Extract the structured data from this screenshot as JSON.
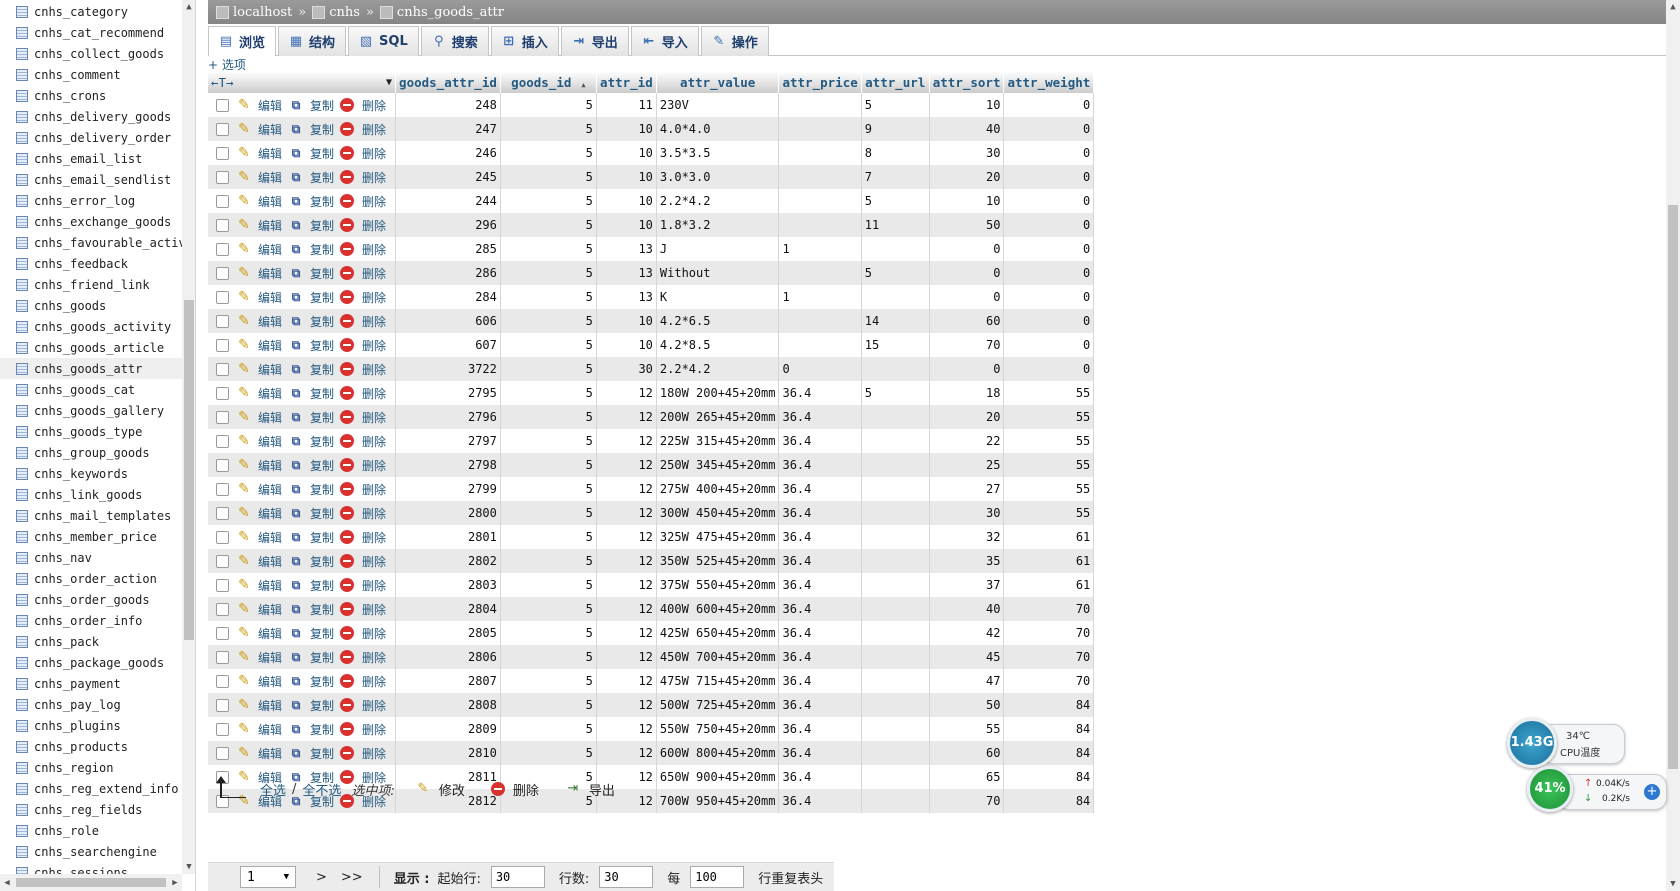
{
  "sidebar": {
    "tables": [
      "cnhs_category",
      "cnhs_cat_recommend",
      "cnhs_collect_goods",
      "cnhs_comment",
      "cnhs_crons",
      "cnhs_delivery_goods",
      "cnhs_delivery_order",
      "cnhs_email_list",
      "cnhs_email_sendlist",
      "cnhs_error_log",
      "cnhs_exchange_goods",
      "cnhs_favourable_activi",
      "cnhs_feedback",
      "cnhs_friend_link",
      "cnhs_goods",
      "cnhs_goods_activity",
      "cnhs_goods_article",
      "cnhs_goods_attr",
      "cnhs_goods_cat",
      "cnhs_goods_gallery",
      "cnhs_goods_type",
      "cnhs_group_goods",
      "cnhs_keywords",
      "cnhs_link_goods",
      "cnhs_mail_templates",
      "cnhs_member_price",
      "cnhs_nav",
      "cnhs_order_action",
      "cnhs_order_goods",
      "cnhs_order_info",
      "cnhs_pack",
      "cnhs_package_goods",
      "cnhs_payment",
      "cnhs_pay_log",
      "cnhs_plugins",
      "cnhs_products",
      "cnhs_region",
      "cnhs_reg_extend_info",
      "cnhs_reg_fields",
      "cnhs_role",
      "cnhs_searchengine",
      "cnhs_sessions"
    ],
    "active_table": "cnhs_goods_attr"
  },
  "breadcrumb": {
    "server": "localhost",
    "database": "cnhs",
    "table": "cnhs_goods_attr",
    "separator": "»"
  },
  "tabs": [
    {
      "label": "浏览",
      "icon": "browse-icon",
      "glyph": "▤"
    },
    {
      "label": "结构",
      "icon": "structure-icon",
      "glyph": "▦"
    },
    {
      "label": "SQL",
      "icon": "sql-icon",
      "glyph": "▧"
    },
    {
      "label": "搜索",
      "icon": "search-icon",
      "glyph": "⚲"
    },
    {
      "label": "插入",
      "icon": "insert-icon",
      "glyph": "⊞"
    },
    {
      "label": "导出",
      "icon": "export-icon",
      "glyph": "⇥"
    },
    {
      "label": "导入",
      "icon": "import-icon",
      "glyph": "⇤"
    },
    {
      "label": "操作",
      "icon": "operations-icon",
      "glyph": "✎"
    }
  ],
  "options_link": "+ 选项",
  "table": {
    "nav_arrows": "←T→",
    "columns": [
      "goods_attr_id",
      "goods_id",
      "attr_id",
      "attr_value",
      "attr_price",
      "attr_url",
      "attr_sort",
      "attr_weight"
    ],
    "sort_indicator": "▲",
    "actions": {
      "edit": "编辑",
      "copy": "复制",
      "delete": "删除"
    },
    "rows": [
      [
        "248",
        "5",
        "11",
        "230V",
        "",
        "5",
        "10",
        "0"
      ],
      [
        "247",
        "5",
        "10",
        "4.0*4.0",
        "",
        "9",
        "40",
        "0"
      ],
      [
        "246",
        "5",
        "10",
        "3.5*3.5",
        "",
        "8",
        "30",
        "0"
      ],
      [
        "245",
        "5",
        "10",
        "3.0*3.0",
        "",
        "7",
        "20",
        "0"
      ],
      [
        "244",
        "5",
        "10",
        "2.2*4.2",
        "",
        "5",
        "10",
        "0"
      ],
      [
        "296",
        "5",
        "10",
        "1.8*3.2",
        "",
        "11",
        "50",
        "0"
      ],
      [
        "285",
        "5",
        "13",
        "J",
        "1",
        "",
        "0",
        "0"
      ],
      [
        "286",
        "5",
        "13",
        "Without",
        "",
        "5",
        "0",
        "0"
      ],
      [
        "284",
        "5",
        "13",
        "K",
        "1",
        "",
        "0",
        "0"
      ],
      [
        "606",
        "5",
        "10",
        "4.2*6.5",
        "",
        "14",
        "60",
        "0"
      ],
      [
        "607",
        "5",
        "10",
        "4.2*8.5",
        "",
        "15",
        "70",
        "0"
      ],
      [
        "3722",
        "5",
        "30",
        "2.2*4.2",
        "0",
        "",
        "0",
        "0"
      ],
      [
        "2795",
        "5",
        "12",
        "180W 200+45+20mm",
        "36.4",
        "5",
        "18",
        "55"
      ],
      [
        "2796",
        "5",
        "12",
        "200W 265+45+20mm",
        "36.4",
        "",
        "20",
        "55"
      ],
      [
        "2797",
        "5",
        "12",
        "225W 315+45+20mm",
        "36.4",
        "",
        "22",
        "55"
      ],
      [
        "2798",
        "5",
        "12",
        "250W 345+45+20mm",
        "36.4",
        "",
        "25",
        "55"
      ],
      [
        "2799",
        "5",
        "12",
        "275W 400+45+20mm",
        "36.4",
        "",
        "27",
        "55"
      ],
      [
        "2800",
        "5",
        "12",
        "300W 450+45+20mm",
        "36.4",
        "",
        "30",
        "55"
      ],
      [
        "2801",
        "5",
        "12",
        "325W 475+45+20mm",
        "36.4",
        "",
        "32",
        "61"
      ],
      [
        "2802",
        "5",
        "12",
        "350W 525+45+20mm",
        "36.4",
        "",
        "35",
        "61"
      ],
      [
        "2803",
        "5",
        "12",
        "375W 550+45+20mm",
        "36.4",
        "",
        "37",
        "61"
      ],
      [
        "2804",
        "5",
        "12",
        "400W 600+45+20mm",
        "36.4",
        "",
        "40",
        "70"
      ],
      [
        "2805",
        "5",
        "12",
        "425W 650+45+20mm",
        "36.4",
        "",
        "42",
        "70"
      ],
      [
        "2806",
        "5",
        "12",
        "450W 700+45+20mm",
        "36.4",
        "",
        "45",
        "70"
      ],
      [
        "2807",
        "5",
        "12",
        "475W 715+45+20mm",
        "36.4",
        "",
        "47",
        "70"
      ],
      [
        "2808",
        "5",
        "12",
        "500W 725+45+20mm",
        "36.4",
        "",
        "50",
        "84"
      ],
      [
        "2809",
        "5",
        "12",
        "550W 750+45+20mm",
        "36.4",
        "",
        "55",
        "84"
      ],
      [
        "2810",
        "5",
        "12",
        "600W 800+45+20mm",
        "36.4",
        "",
        "60",
        "84"
      ],
      [
        "2811",
        "5",
        "12",
        "650W 900+45+20mm",
        "36.4",
        "",
        "65",
        "84"
      ],
      [
        "2812",
        "5",
        "12",
        "700W 950+45+20mm",
        "36.4",
        "",
        "70",
        "84"
      ]
    ]
  },
  "bulk": {
    "select_all": "全选",
    "separator": "/",
    "deselect_all": "全不选",
    "with_selected": "选中项:",
    "modify": "修改",
    "delete": "删除",
    "export": "导出"
  },
  "pagination": {
    "page": "1",
    "next": ">",
    "last": ">>",
    "show_label": "显示 :",
    "start_label": "起始行:",
    "start_value": "30",
    "rows_label": "行数:",
    "rows_value": "30",
    "every_label": "每",
    "every_value": "100",
    "repeat_label": "行重复表头"
  },
  "monitor": {
    "memory": "1.43G",
    "cpu_temp": "34℃",
    "cpu_label": "CPU温度",
    "load": "41%",
    "upload": "0.04K/s",
    "download": "0.2K/s"
  },
  "colors": {
    "link": "#235a81",
    "header_bar": "#8c8c8c",
    "row_alt": "#e9e9e9",
    "delete_icon": "#d8322e",
    "edit_icon": "#d39b12"
  }
}
